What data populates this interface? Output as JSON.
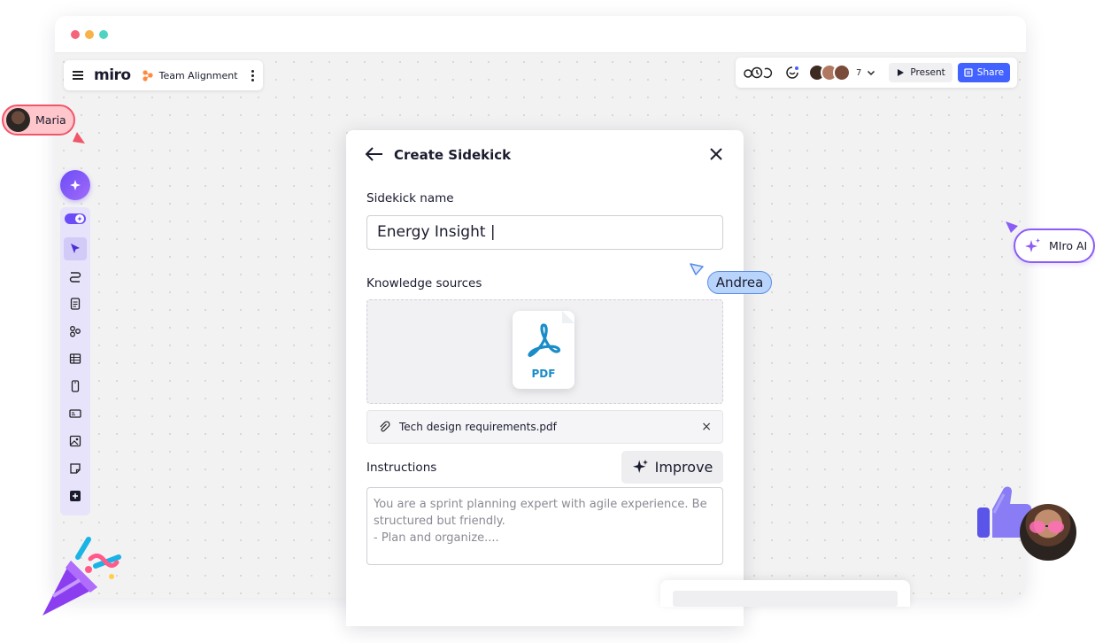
{
  "board": {
    "logo": "miro",
    "name": "Team Alignment"
  },
  "topbar": {
    "avatar_count": "7",
    "present_label": "Present",
    "share_label": "Share"
  },
  "modal": {
    "title": "Create Sidekick",
    "name_label": "Sidekick name",
    "name_value": "Energy Insight |",
    "knowledge_label": "Knowledge sources",
    "pdf_label": "PDF",
    "file_name": "Tech design requirements.pdf",
    "file_remove": "×",
    "instructions_label": "Instructions",
    "improve_label": "Improve",
    "instructions_placeholder": "You are a sprint planning expert with agile experience. Be structured but friendly.\n- Plan and organize...."
  },
  "cursors": {
    "maria": "Maria",
    "andrea": "Andrea",
    "ai": "MIro AI"
  },
  "colors": {
    "accent": "#4262ff",
    "ai_purple": "#8b5cf6",
    "maria": "#f0566a",
    "andrea": "#5a8de8",
    "pdf": "#1a8cc7"
  },
  "icons": [
    "hamburger-icon",
    "board-icon",
    "kebab-icon",
    "timer-icon",
    "reactions-icon",
    "play-icon",
    "share-icon",
    "sparkle-icon",
    "toggle-icon",
    "cursor-icon",
    "connector-icon",
    "doc-icon",
    "diagram-icon",
    "table-icon",
    "frame-icon",
    "card-icon",
    "image-icon",
    "sticky-note-icon",
    "plus-icon",
    "arrow-left-icon",
    "close-icon",
    "pdf-icon",
    "paperclip-icon"
  ]
}
